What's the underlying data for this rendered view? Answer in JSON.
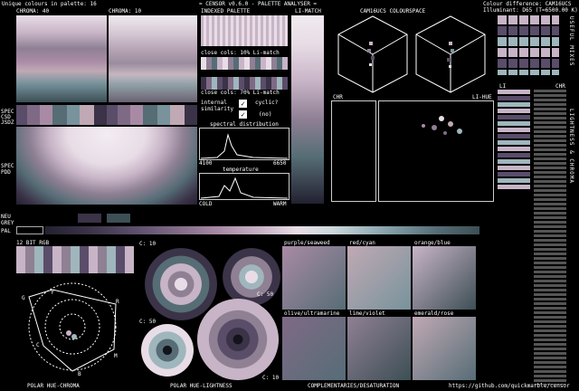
{
  "header": {
    "unique_colours": "Unique colours in palette: 16",
    "title": "= CENSOR v0.6.0 - PALETTE ANALYSER =",
    "colour_difference": "Colour difference: CAM16UCS",
    "illuminant": "Illuminant: D65 (T=6500.00 K)"
  },
  "labels": {
    "chroma40": "CHROMA: 40",
    "chroma10": "CHROMA: 10",
    "indexed_palette": "INDEXED PALETTE",
    "li_match": "LI-MATCH",
    "cam16ucs": "CAM16UCS COLOURSPACE",
    "close10": "close cols: 10% Li-match",
    "close70": "close cols: 70% Li-match",
    "internal_similarity": "internal similarity",
    "cyclic": "cyclic?",
    "cyclic_value": "(no)",
    "spectral": "spectral distribution",
    "spec_min": "4100",
    "spec_max": "6650",
    "temperature": "temperature",
    "cold": "COLD",
    "warm": "WARM",
    "chr": "CHR",
    "li_hue": "LI-HUE",
    "li": "LI",
    "chr2": "CHR",
    "spec": "SPEC",
    "csd": "CSD",
    "jsdz": "JSDZ",
    "spec2": "SPEC",
    "pdd": "PDD",
    "neu": "NEU",
    "grey": "GREY",
    "pal": "PAL",
    "rgb12": "12 BIT RGB",
    "c10a": "C: 10",
    "c50a": "C: 50",
    "c50b": "C: 50",
    "c10b": "C: 10",
    "purple_seaweed": "purple/seaweed",
    "red_cyan": "red/cyan",
    "orange_blue": "orange/blue",
    "olive_ultramarine": "olive/ultramarine",
    "lime_violet": "lime/violet",
    "emerald_rose": "emerald/rose",
    "polar_hue_chroma": "POLAR HUE-CHROMA",
    "polar_hue_lightness": "POLAR HUE-LIGHTNESS",
    "complementaries": "COMPLEMENTARIES/DESATURATION",
    "github": "https://github.com/quickmarble/censor",
    "side_useful": "USEFUL MIXES",
    "side_lightness": "LIGHTNESS & CHROMA",
    "hue_G": "G",
    "hue_Y": "Y",
    "hue_R": "R",
    "hue_M": "M",
    "hue_B": "B",
    "hue_C": "C"
  },
  "palette": [
    "#e8dde6",
    "#c8b4c7",
    "#a98aa5",
    "#7f6a86",
    "#5a4d6a",
    "#3b3348",
    "#232130",
    "#14131c",
    "#cdd8dc",
    "#9fb6bd",
    "#78939c",
    "#566d76",
    "#3d4f55",
    "#c0a9b4",
    "#8f8094",
    "#6b6272"
  ]
}
